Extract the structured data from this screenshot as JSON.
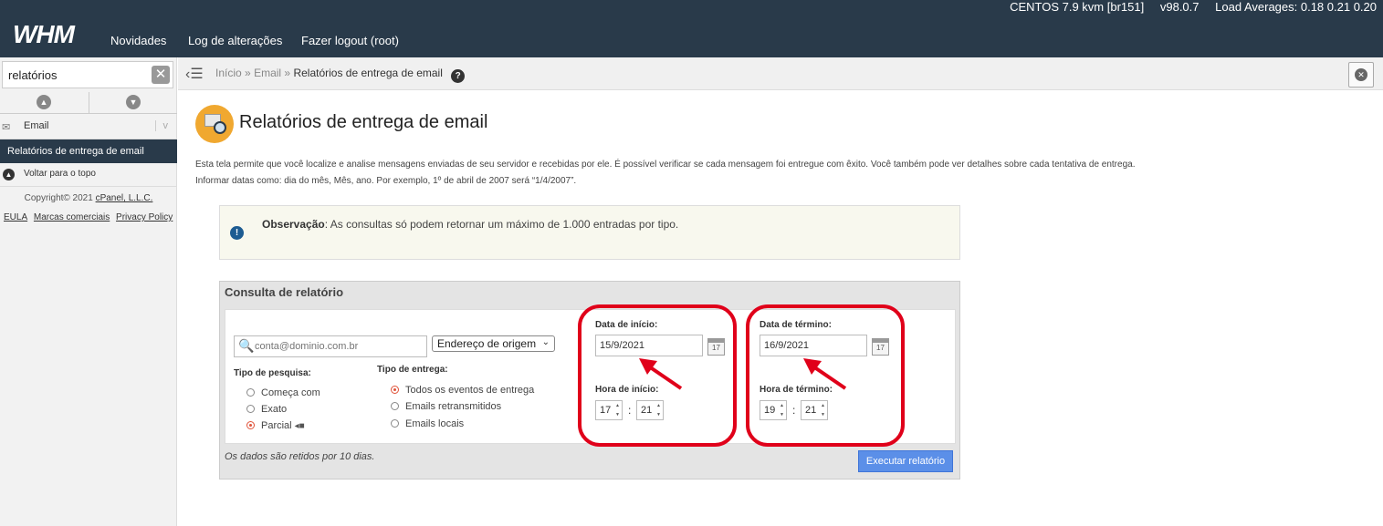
{
  "topbar": {
    "logo": "WHM",
    "nav": [
      "Novidades",
      "Log de alterações",
      "Fazer logout (root)"
    ],
    "os": "CENTOS 7.9 kvm [br151]",
    "version": "v98.0.7",
    "load": "Load Averages: 0.18 0.21 0.20"
  },
  "sidebar": {
    "search_value": "relatórios",
    "section": "Email",
    "active_item": "Relatórios de entrega de email",
    "back_to_top": "Voltar para o topo",
    "copyright_prefix": "Copyright© 2021 ",
    "copyright_link": "cPanel, L.L.C.",
    "links": [
      "EULA",
      "Marcas comerciais",
      "Privacy Policy"
    ]
  },
  "breadcrumb": {
    "items": [
      "Início",
      "Email"
    ],
    "separator": "»",
    "current": "Relatórios de entrega de email"
  },
  "page": {
    "title": "Relatórios de entrega de email",
    "intro_line1": "Esta tela permite que você localize e analise mensagens enviadas de seu servidor e recebidas por ele. É possível verificar se cada mensagem foi entregue com êxito. Você também pode ver detalhes sobre cada tentativa de entrega.",
    "intro_line2": "Informar datas como: dia do mês, Mês, ano. Por exemplo, 1º de abril de 2007 será “1/4/2007”.",
    "note_label": "Observação",
    "note_text": ": As consultas só podem retornar um máximo de 1.000 entradas por tipo."
  },
  "query": {
    "title": "Consulta de relatório",
    "email_placeholder": "conta@dominio.com.br",
    "origin_select": "Endereço de origem",
    "search_type_label": "Tipo de pesquisa:",
    "search_types": [
      "Começa com",
      "Exato",
      "Parcial"
    ],
    "search_type_selected": "Parcial",
    "delivery_type_label": "Tipo de entrega:",
    "delivery_types": [
      "Todos os eventos de entrega",
      "Emails retransmitidos",
      "Emails locais"
    ],
    "delivery_type_selected": "Todos os eventos de entrega",
    "start_date_label": "Data de início:",
    "start_date": "15/9/2021",
    "start_time_label": "Hora de início:",
    "start_hour": "17",
    "start_minute": "21",
    "end_date_label": "Data de término:",
    "end_date": "16/9/2021",
    "end_time_label": "Hora de término:",
    "end_hour": "19",
    "end_minute": "21",
    "calendar_day": "17",
    "time_separator": ":",
    "retention_note": "Os dados são retidos por 10 dias.",
    "run_button": "Executar relatório"
  },
  "colors": {
    "topbar": "#293a4a",
    "highlight_ring": "#e0001a",
    "run_button": "#5b8fe8",
    "radio_selected": "#e0533a"
  },
  "icons": [
    "search-icon",
    "clear-icon",
    "chevron-up-icon",
    "chevron-down-icon",
    "email-icon",
    "arrow-up-icon",
    "menu-icon",
    "help-icon",
    "close-icon",
    "info-icon",
    "calendar-icon",
    "tag-icon"
  ]
}
